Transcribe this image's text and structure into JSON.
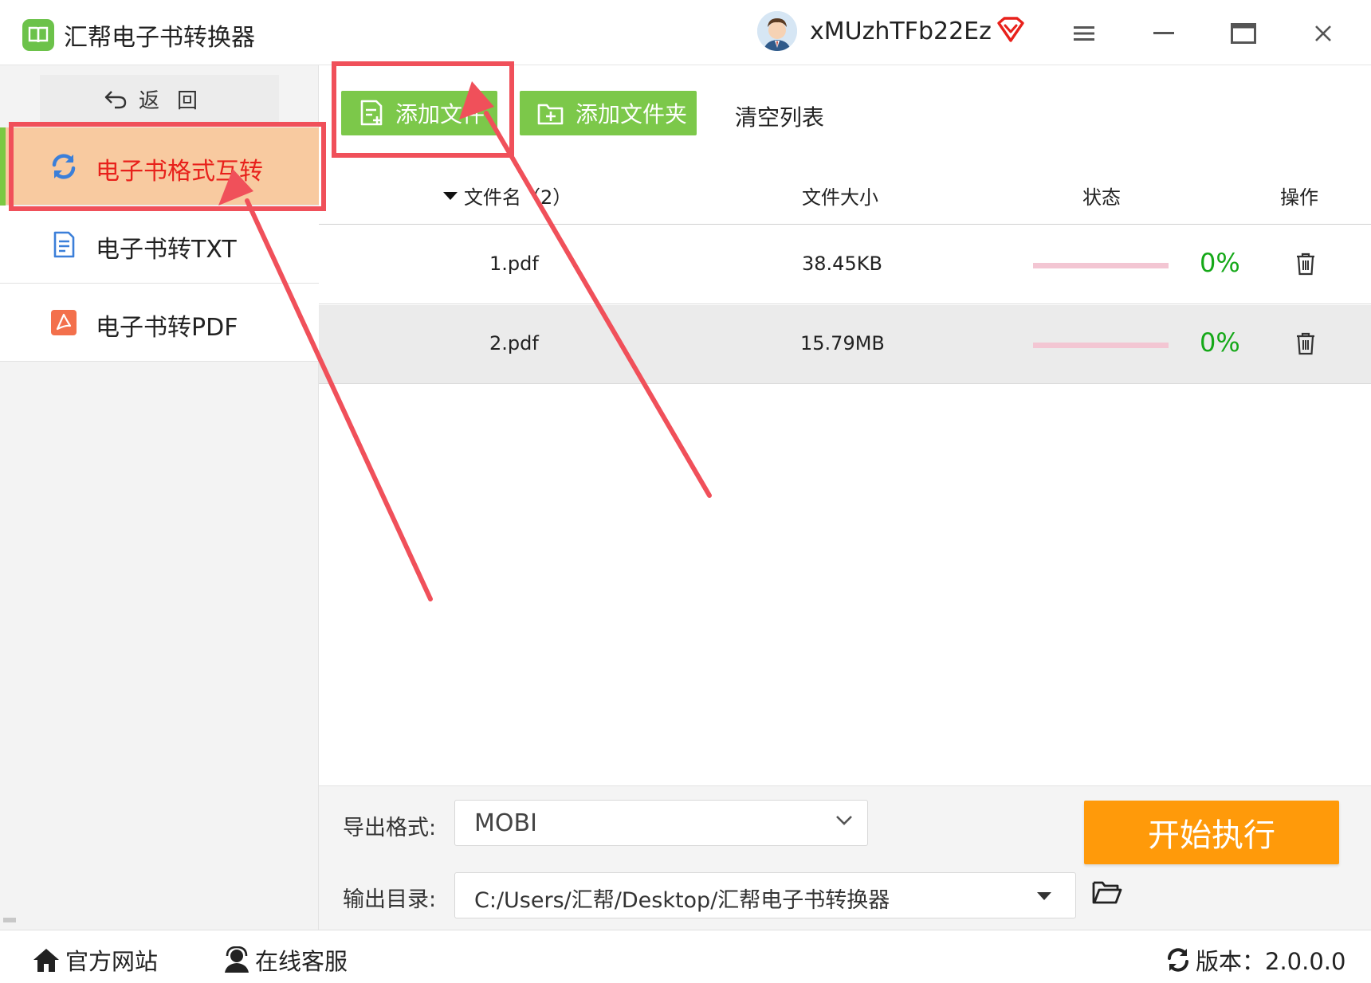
{
  "app": {
    "title": "汇帮电子书转换器",
    "username": "xMUzhTFb22Ez"
  },
  "sidebar": {
    "back_label": "返回",
    "items": [
      {
        "label": "电子书格式互转",
        "icon": "refresh-icon",
        "active": true
      },
      {
        "label": "电子书转TXT",
        "icon": "document-icon",
        "active": false
      },
      {
        "label": "电子书转PDF",
        "icon": "pdf-icon",
        "active": false
      }
    ]
  },
  "toolbar": {
    "add_file_label": "添加文件",
    "add_folder_label": "添加文件夹",
    "clear_label": "清空列表"
  },
  "table": {
    "headers": {
      "name": "文件名（2）",
      "size": "文件大小",
      "status": "状态",
      "action": "操作"
    },
    "rows": [
      {
        "name": "1.pdf",
        "size": "38.45KB",
        "progress": "0%"
      },
      {
        "name": "2.pdf",
        "size": "15.79MB",
        "progress": "0%"
      }
    ]
  },
  "output": {
    "format_label": "导出格式:",
    "format_value": "MOBI",
    "dir_label": "输出目录:",
    "dir_value": "C:/Users/汇帮/Desktop/汇帮电子书转换器",
    "start_label": "开始执行"
  },
  "footer": {
    "website_label": "官方网站",
    "support_label": "在线客服",
    "version_text": "版本：2.0.0.0"
  },
  "colors": {
    "accent_green": "#7cc84a",
    "start_orange": "#ff9a0a",
    "active_bg": "#f8caa0",
    "active_text": "#e8211b",
    "annotation_red": "#f0505a",
    "percent_green": "#15a818"
  }
}
